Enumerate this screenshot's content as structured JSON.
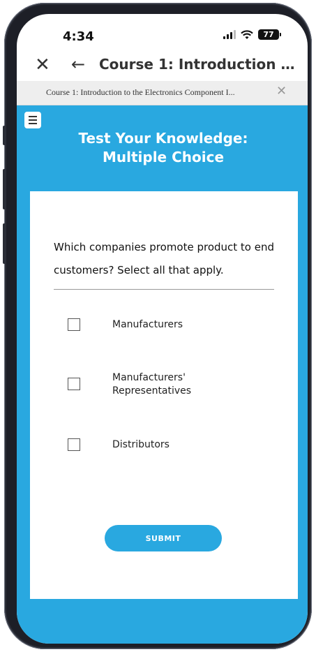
{
  "status_bar": {
    "time": "4:34",
    "battery": "77"
  },
  "app_header": {
    "close_icon": "close-icon",
    "back_icon": "back-arrow-icon",
    "title": "Course 1: Introduction to t..."
  },
  "tab_bar": {
    "title": "Course 1: Introduction to the Electronics Component I...",
    "close_icon": "close-icon"
  },
  "quiz": {
    "menu_icon": "hamburger-menu-icon",
    "title": "Test Your Knowledge: Multiple Choice",
    "question": "Which companies promote product to end customers? Select all that apply.",
    "options": [
      {
        "label": "Manufacturers",
        "checked": false
      },
      {
        "label": "Manufacturers' Representatives",
        "checked": false
      },
      {
        "label": "Distributors",
        "checked": false
      }
    ],
    "submit_label": "SUBMIT"
  },
  "colors": {
    "accent": "#29a8e0",
    "card": "#ffffff",
    "tab_bar": "#eeeeee"
  }
}
